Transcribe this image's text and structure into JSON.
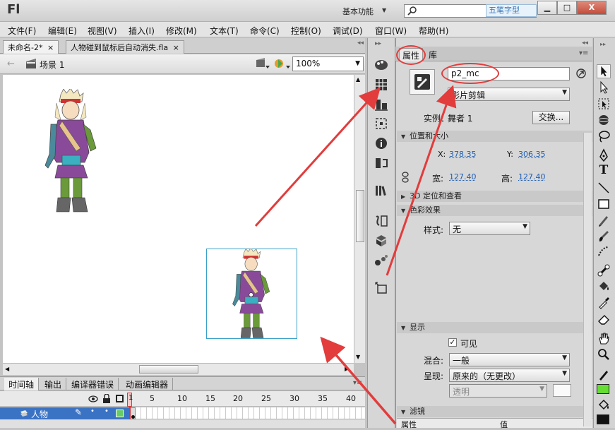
{
  "app": {
    "logo": "Fl",
    "workspace": "基本功能",
    "watermark": "五笔字型",
    "window_buttons": {
      "minimize": "▁",
      "maximize": "□",
      "close": "X"
    }
  },
  "menu": [
    "文件(F)",
    "编辑(E)",
    "视图(V)",
    "插入(I)",
    "修改(M)",
    "文本(T)",
    "命令(C)",
    "控制(O)",
    "调试(D)",
    "窗口(W)",
    "帮助(H)"
  ],
  "doc_tabs": [
    {
      "label": "未命名-2*",
      "close": "×"
    },
    {
      "label": "人物碰到鼠标后自动消失.fla",
      "close": "×"
    }
  ],
  "scene": {
    "label": "场景 1",
    "zoom": "100%"
  },
  "timeline": {
    "tabs": [
      "时间轴",
      "输出",
      "编译器错误",
      "动画编辑器"
    ],
    "frame_numbers": [
      "1",
      "5",
      "10",
      "15",
      "20",
      "25",
      "30",
      "35",
      "40"
    ],
    "layer_name": "人物",
    "current_frame": "1"
  },
  "properties": {
    "tabs": [
      "属性",
      "库"
    ],
    "instance_name": "p2_mc",
    "symbol_type": "影片剪辑",
    "instance_label": "实例：",
    "instance_of": "舞者 1",
    "swap_button": "交换...",
    "sections": {
      "position": "位置和大小",
      "3d": "3D 定位和查看",
      "color": "色彩效果",
      "display": "显示",
      "filters": "滤镜"
    },
    "x_label": "X:",
    "x_value": "378.35",
    "y_label": "Y:",
    "y_value": "306.35",
    "w_label": "宽:",
    "w_value": "127.40",
    "h_label": "高:",
    "h_value": "127.40",
    "style_label": "样式:",
    "style_value": "无",
    "visible_label": "可见",
    "blend_label": "混合:",
    "blend_value": "一般",
    "render_label": "呈现:",
    "render_value": "原来的（无更改）",
    "transparent_value": "透明",
    "filter_col_property": "属性",
    "filter_col_value": "值"
  },
  "colors": {
    "accent_red": "#e23c3c",
    "layer_highlight": "#3b73c4",
    "fill_color": "#66dd33",
    "selection_box": "#3aa0c8"
  }
}
